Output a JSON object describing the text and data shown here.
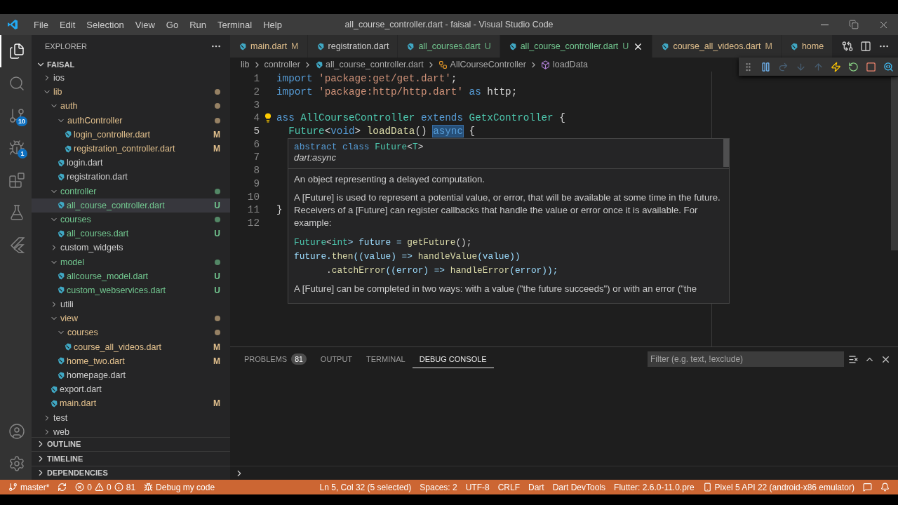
{
  "title_bar": {
    "menu": [
      "File",
      "Edit",
      "Selection",
      "View",
      "Go",
      "Run",
      "Terminal",
      "Help"
    ],
    "title": "all_course_controller.dart - faisal - Visual Studio Code"
  },
  "activity_bar": {
    "items": [
      {
        "kind": "explorer",
        "selected": true
      },
      {
        "kind": "search",
        "selected": false
      },
      {
        "kind": "source_control",
        "badge": "10",
        "selected": false
      },
      {
        "kind": "run_debug",
        "badge": "1",
        "selected": false
      },
      {
        "kind": "extensions",
        "selected": false
      },
      {
        "kind": "testing",
        "selected": false
      },
      {
        "kind": "flutter",
        "selected": false
      }
    ],
    "bottom": [
      {
        "kind": "accounts"
      },
      {
        "kind": "settings"
      }
    ]
  },
  "sidebar": {
    "title": "EXPLORER",
    "folder": "FAISAL",
    "tree": [
      {
        "name": "ios",
        "kind": "folder",
        "expanded": false,
        "color": "#cccccc"
      },
      {
        "name": "lib",
        "kind": "folder",
        "expanded": true,
        "color": "#e2c08d",
        "dot": true,
        "children": [
          {
            "name": "auth",
            "kind": "folder",
            "expanded": true,
            "color": "#e2c08d",
            "dot": true,
            "children": [
              {
                "name": "authController",
                "kind": "folder",
                "expanded": true,
                "color": "#e2c08d",
                "dot": true,
                "children": [
                  {
                    "name": "login_controller.dart",
                    "kind": "file",
                    "color": "#e2c08d",
                    "badge": "M",
                    "selected": false
                  },
                  {
                    "name": "registration_controller.dart",
                    "kind": "file",
                    "color": "#e2c08d",
                    "badge": "M",
                    "selected": false
                  }
                ]
              },
              {
                "name": "login.dart",
                "kind": "file",
                "color": "#cccccc",
                "selected": false
              },
              {
                "name": "registration.dart",
                "kind": "file",
                "color": "#cccccc",
                "selected": false
              }
            ]
          },
          {
            "name": "controller",
            "kind": "folder",
            "expanded": true,
            "color": "#73c991",
            "dot": true,
            "children": [
              {
                "name": "all_course_controller.dart",
                "kind": "file",
                "color": "#73c991",
                "badge": "U",
                "selected": true
              }
            ]
          },
          {
            "name": "courses",
            "kind": "folder",
            "expanded": true,
            "color": "#73c991",
            "dot": true,
            "children": [
              {
                "name": "all_courses.dart",
                "kind": "file",
                "color": "#73c991",
                "badge": "U",
                "selected": false
              }
            ]
          },
          {
            "name": "custom_widgets",
            "kind": "folder",
            "expanded": false,
            "color": "#cccccc"
          },
          {
            "name": "model",
            "kind": "folder",
            "expanded": true,
            "color": "#73c991",
            "dot": true,
            "children": [
              {
                "name": "allcourse_model.dart",
                "kind": "file",
                "color": "#73c991",
                "badge": "U",
                "selected": false
              },
              {
                "name": "custom_webservices.dart",
                "kind": "file",
                "color": "#73c991",
                "badge": "U",
                "selected": false
              }
            ]
          },
          {
            "name": "utili",
            "kind": "folder",
            "expanded": false,
            "color": "#cccccc"
          },
          {
            "name": "view",
            "kind": "folder",
            "expanded": true,
            "color": "#e2c08d",
            "dot": true,
            "children": [
              {
                "name": "courses",
                "kind": "folder",
                "expanded": true,
                "color": "#e2c08d",
                "dot": true,
                "children": [
                  {
                    "name": "course_all_videos.dart",
                    "kind": "file",
                    "color": "#e2c08d",
                    "badge": "M",
                    "selected": false
                  }
                ]
              },
              {
                "name": "home_two.dart",
                "kind": "file",
                "color": "#e2c08d",
                "badge": "M",
                "selected": false
              },
              {
                "name": "homepage.dart",
                "kind": "file",
                "color": "#cccccc",
                "selected": false
              }
            ]
          },
          {
            "name": "export.dart",
            "kind": "file",
            "color": "#cccccc",
            "selected": false
          },
          {
            "name": "main.dart",
            "kind": "file",
            "color": "#e2c08d",
            "badge": "M",
            "selected": false
          }
        ]
      },
      {
        "name": "test",
        "kind": "folder",
        "expanded": false,
        "color": "#cccccc"
      },
      {
        "name": "web",
        "kind": "folder",
        "expanded": false,
        "color": "#cccccc"
      }
    ],
    "sections": [
      "OUTLINE",
      "TIMELINE",
      "DEPENDENCIES"
    ]
  },
  "editor": {
    "tabs": [
      {
        "label": "main.dart",
        "badge": "M",
        "color": "#e2c08d",
        "selected": false
      },
      {
        "label": "registration.dart",
        "color": "#cccccc",
        "selected": false
      },
      {
        "label": "all_courses.dart",
        "badge": "U",
        "color": "#73c991",
        "selected": false
      },
      {
        "label": "all_course_controller.dart",
        "badge": "U",
        "color": "#73c991",
        "selected": true
      },
      {
        "label": "course_all_videos.dart",
        "badge": "M",
        "color": "#e2c08d",
        "selected": false
      },
      {
        "label": "home",
        "color": "#e2c08d",
        "selected": false
      }
    ],
    "breadcrumbs": [
      {
        "label": "lib",
        "kind": "folder"
      },
      {
        "label": "controller",
        "kind": "folder"
      },
      {
        "label": "all_course_controller.dart",
        "kind": "file"
      },
      {
        "label": "AllCourseController",
        "kind": "class"
      },
      {
        "label": "loadData",
        "kind": "method"
      }
    ],
    "lines": [
      {
        "number": "1",
        "tokens": [
          {
            "text": "import ",
            "kind": "kw"
          },
          {
            "text": "'package:get/get.dart'",
            "kind": "str"
          },
          {
            "text": ";",
            "kind": "plain"
          }
        ]
      },
      {
        "number": "2",
        "tokens": [
          {
            "text": "import ",
            "kind": "kw"
          },
          {
            "text": "'package:http/http.dart'",
            "kind": "str"
          },
          {
            "text": " as ",
            "kind": "kw"
          },
          {
            "text": "http;",
            "kind": "plain"
          }
        ]
      },
      {
        "number": "3"
      },
      {
        "number": "4",
        "lightbulb": true,
        "tokens": [
          {
            "text": "ass ",
            "kind": "kw"
          },
          {
            "text": "AllCourseController ",
            "kind": "type"
          },
          {
            "text": "extends ",
            "kind": "kw"
          },
          {
            "text": "GetxController ",
            "kind": "type"
          },
          {
            "text": "{",
            "kind": "plain"
          }
        ]
      },
      {
        "number": "5",
        "tokens": [
          {
            "text": "  Future",
            "kind": "type"
          },
          {
            "text": "<",
            "kind": "plain"
          },
          {
            "text": "void",
            "kind": "kw"
          },
          {
            "text": "> ",
            "kind": "plain"
          },
          {
            "text": "loadData",
            "kind": "fn"
          },
          {
            "text": "() ",
            "kind": "plain"
          },
          {
            "text": "async",
            "kind": "kw",
            "selected": true
          },
          {
            "text": " {",
            "kind": "plain"
          }
        ]
      },
      {
        "number": "6"
      },
      {
        "number": "7"
      },
      {
        "number": "8"
      },
      {
        "number": "9"
      },
      {
        "number": "10"
      },
      {
        "number": "11",
        "tokens": [
          {
            "text": "}",
            "kind": "plain"
          }
        ]
      },
      {
        "number": "12"
      }
    ],
    "hover": {
      "signature": [
        {
          "text": "abstract class ",
          "kind": "kw"
        },
        {
          "text": "Future",
          "kind": "type"
        },
        {
          "text": "<",
          "kind": "plain"
        },
        {
          "text": "T",
          "kind": "type"
        },
        {
          "text": ">",
          "kind": "plain"
        }
      ],
      "library": "dart:async",
      "paragraphs": [
        "An object representing a delayed computation.",
        "A [Future] is used to represent a potential value, or error, that will be available at some time in the future. Receivers of a [Future] can register callbacks that handle the value or error once it is available. For example:"
      ],
      "example": [
        [
          {
            "text": "Future",
            "kind": "type"
          },
          {
            "text": "<",
            "kind": "plain"
          },
          {
            "text": "int",
            "kind": "type"
          },
          {
            "text": "> future = ",
            "kind": "var"
          },
          {
            "text": "getFuture",
            "kind": "fn"
          },
          {
            "text": "();",
            "kind": "plain"
          }
        ],
        [
          {
            "text": "future.",
            "kind": "var"
          },
          {
            "text": "then",
            "kind": "fn"
          },
          {
            "text": "((value) => ",
            "kind": "var"
          },
          {
            "text": "handleValue",
            "kind": "fn"
          },
          {
            "text": "(value))",
            "kind": "var"
          }
        ],
        [
          {
            "text": "      .",
            "kind": "plain"
          },
          {
            "text": "catchError",
            "kind": "fn"
          },
          {
            "text": "((error) => ",
            "kind": "var"
          },
          {
            "text": "handleError",
            "kind": "fn"
          },
          {
            "text": "(error));",
            "kind": "var"
          }
        ]
      ],
      "closing": "A [Future] can be completed in two ways: with a value (\"the future succeeds\") or with an error (\"the"
    }
  },
  "debug_toolbar": [
    {
      "kind": "grip",
      "disabled": false
    },
    {
      "kind": "pause",
      "disabled": false
    },
    {
      "kind": "step_over",
      "disabled": true
    },
    {
      "kind": "step_into",
      "disabled": true
    },
    {
      "kind": "step_out",
      "disabled": true
    },
    {
      "kind": "hot_reload",
      "disabled": false
    },
    {
      "kind": "restart",
      "disabled": false
    },
    {
      "kind": "stop",
      "disabled": false
    },
    {
      "kind": "devtools",
      "disabled": false
    }
  ],
  "panel": {
    "tabs": [
      {
        "label": "PROBLEMS",
        "count": "81",
        "selected": false
      },
      {
        "label": "OUTPUT",
        "selected": false
      },
      {
        "label": "TERMINAL",
        "selected": false
      },
      {
        "label": "DEBUG CONSOLE",
        "selected": true
      }
    ],
    "filter_placeholder": "Filter (e.g. text, !exclude)"
  },
  "status_bar": {
    "left": [
      {
        "kind": "branch",
        "text": "master*"
      },
      {
        "kind": "sync"
      },
      {
        "kind": "problems",
        "errors": "0",
        "warnings": "0",
        "infos": "81"
      },
      {
        "kind": "debug",
        "text": "Debug my code"
      }
    ],
    "right": [
      {
        "kind": "text",
        "text": "Ln 5, Col 32 (5 selected)"
      },
      {
        "kind": "text",
        "text": "Spaces: 2"
      },
      {
        "kind": "text",
        "text": "UTF-8"
      },
      {
        "kind": "text",
        "text": "CRLF"
      },
      {
        "kind": "text",
        "text": "Dart"
      },
      {
        "kind": "text",
        "text": "Dart DevTools"
      },
      {
        "kind": "text",
        "text": "Flutter: 2.6.0-11.0.pre"
      },
      {
        "kind": "device",
        "text": "Pixel 5 API 22 (android-x86 emulator)"
      },
      {
        "kind": "feedback"
      },
      {
        "kind": "bell"
      }
    ]
  }
}
